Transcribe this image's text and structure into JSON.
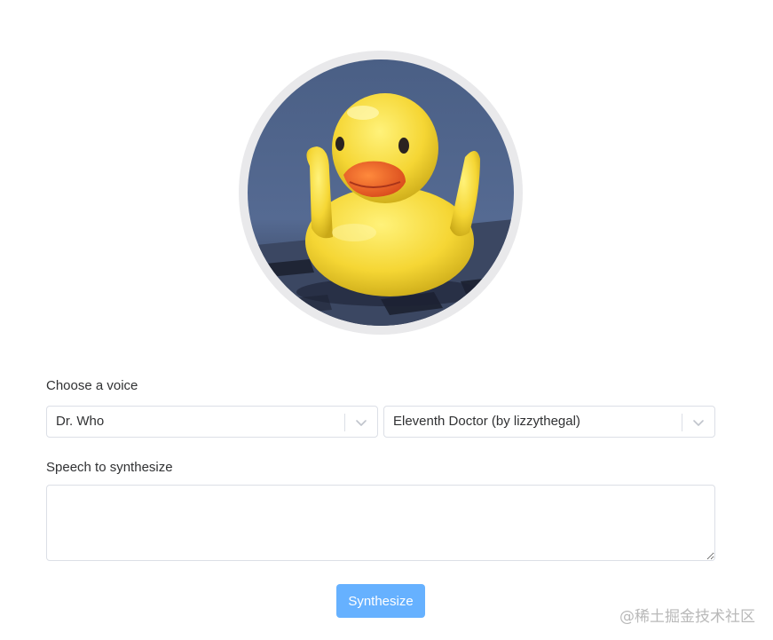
{
  "avatar": {
    "image_subject": "yellow rubber duck"
  },
  "voice": {
    "label": "Choose a voice",
    "category_value": "Dr. Who",
    "voice_value": "Eleventh Doctor (by lizzythegal)"
  },
  "speech": {
    "label": "Speech to synthesize",
    "value": ""
  },
  "actions": {
    "synthesize_label": "Synthesize"
  },
  "watermark": {
    "text": "@稀土掘金技术社区"
  },
  "colors": {
    "primary_light": "#66b1ff",
    "border": "#dcdfe6",
    "text": "#303133",
    "ring": "#e9e9eb"
  }
}
